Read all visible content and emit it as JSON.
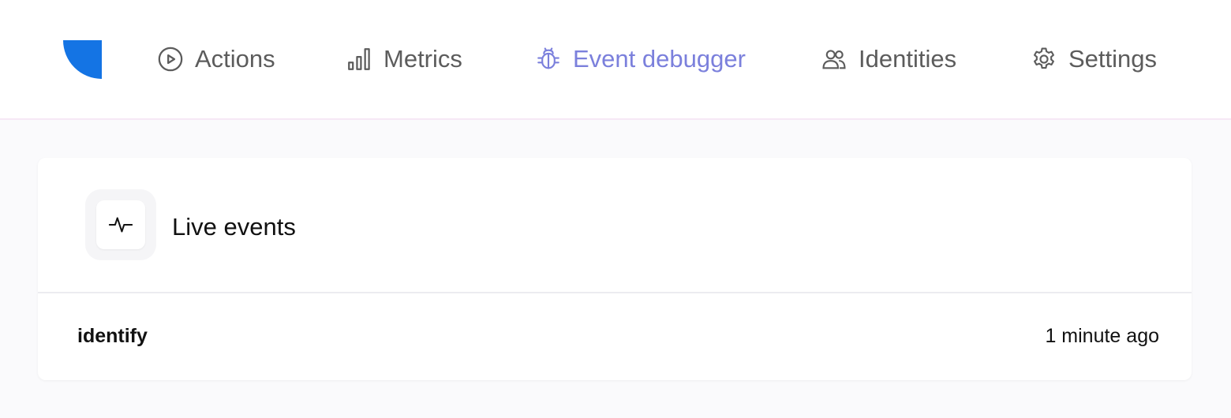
{
  "nav": {
    "logo_color": "#1474e4",
    "active_color": "#7b80dc",
    "items": [
      {
        "label": "Actions",
        "icon": "play-circle-icon"
      },
      {
        "label": "Metrics",
        "icon": "bar-chart-icon"
      },
      {
        "label": "Event debugger",
        "icon": "bug-icon"
      },
      {
        "label": "Identities",
        "icon": "users-icon"
      },
      {
        "label": "Settings",
        "icon": "gear-icon"
      }
    ]
  },
  "card": {
    "title": "Live events",
    "icon": "activity-pulse-icon",
    "events": [
      {
        "name": "identify",
        "time": "1 minute ago"
      }
    ]
  }
}
